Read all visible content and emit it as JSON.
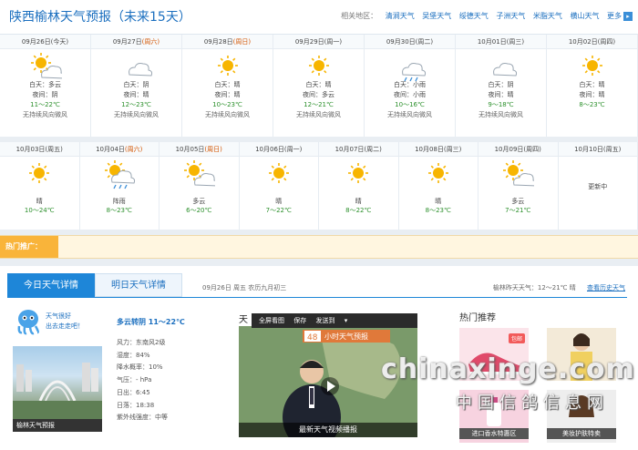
{
  "header": {
    "title": "陕西榆林天气预报（未来15天）",
    "nearby_label": "相关地区：",
    "nearby": [
      "清涧天气",
      "吴堡天气",
      "绥德天气",
      "子洲天气",
      "米脂天气",
      "横山天气"
    ],
    "more": "更多"
  },
  "row1": [
    {
      "date": "09月26日",
      "week": "(今天)",
      "day": "白天：多云",
      "night": "夜间：阴",
      "temp": "11～22℃",
      "wind": "无持续风向微风",
      "icon": "partly-cloudy-icon",
      "weekend": false
    },
    {
      "date": "09月27日",
      "week": "(周六)",
      "day": "白天：阴",
      "night": "夜间：晴",
      "temp": "12～23℃",
      "wind": "无持续风向微风",
      "icon": "cloud-icon",
      "weekend": true
    },
    {
      "date": "09月28日",
      "week": "(周日)",
      "day": "白天：晴",
      "night": "夜间：晴",
      "temp": "10～23℃",
      "wind": "无持续风向微风",
      "icon": "sun-icon",
      "weekend": true
    },
    {
      "date": "09月29日",
      "week": "(周一)",
      "day": "白天：晴",
      "night": "夜间：多云",
      "temp": "12～21℃",
      "wind": "无持续风向微风",
      "icon": "sun-icon",
      "weekend": false
    },
    {
      "date": "09月30日",
      "week": "(周二)",
      "day": "白天：小雨",
      "night": "夜间：小雨",
      "temp": "10～16℃",
      "wind": "无持续风向微风",
      "icon": "rain-icon",
      "weekend": false
    },
    {
      "date": "10月01日",
      "week": "(周三)",
      "day": "白天：阴",
      "night": "夜间：晴",
      "temp": "9～18℃",
      "wind": "无持续风向微风",
      "icon": "cloud-icon",
      "weekend": false
    },
    {
      "date": "10月02日",
      "week": "(周四)",
      "day": "白天：晴",
      "night": "夜间：晴",
      "temp": "8～23℃",
      "wind": "",
      "icon": "sun-icon",
      "weekend": false
    }
  ],
  "row2": [
    {
      "date": "10月03日",
      "week": "(周五)",
      "cond": "晴",
      "temp": "10～24℃",
      "icon": "sun-icon"
    },
    {
      "date": "10月04日",
      "week": "(周六)",
      "cond": "阵雨",
      "temp": "8～23℃",
      "icon": "shower-icon"
    },
    {
      "date": "10月05日",
      "week": "(周日)",
      "cond": "多云",
      "temp": "6～20℃",
      "icon": "partly-cloudy-icon"
    },
    {
      "date": "10月06日",
      "week": "(周一)",
      "cond": "晴",
      "temp": "7～22℃",
      "icon": "sun-icon"
    },
    {
      "date": "10月07日",
      "week": "(周二)",
      "cond": "晴",
      "temp": "8～22℃",
      "icon": "sun-icon"
    },
    {
      "date": "10月08日",
      "week": "(周三)",
      "cond": "晴",
      "temp": "8～23℃",
      "icon": "sun-icon"
    },
    {
      "date": "10月09日",
      "week": "(周四)",
      "cond": "多云",
      "temp": "7～21℃",
      "icon": "partly-cloudy-icon"
    },
    {
      "date": "10月10日",
      "week": "(周五)",
      "cond": "更新中",
      "temp": "",
      "icon": ""
    }
  ],
  "promo": {
    "label": "热门推广："
  },
  "details": {
    "tab_today": "今日天气详情",
    "tab_tomorrow": "明日天气详情",
    "date_line": "09月26日  周五  农历九月初三",
    "yesterday": "榆林昨天天气：12～21℃  晴",
    "history_link": "查看历史天气",
    "mascot_text_1": "天气很好",
    "mascot_text_2": "出去走走吧！",
    "summary": "多云转阴  11～22℃",
    "items": [
      "风力：东南风2级",
      "湿度：84%",
      "降水概率：10%",
      "气压：- hPa",
      "日出：6:45",
      "日落：18:38",
      "紫外线强度：中等"
    ],
    "photo_caption": "榆林天气预报"
  },
  "video": {
    "title": "天",
    "toolbar": [
      "全屏看图",
      "保存",
      "发送到"
    ],
    "caption": "最新天气视频播报",
    "inner_label": "小时天气预报",
    "inner_number": "48"
  },
  "hot": {
    "title": "热门推荐",
    "badge": "包邮",
    "captions": [
      "进口香水特惠区",
      "美妆护肤特卖"
    ]
  },
  "watermark": {
    "line1": "chinaxinge.com",
    "line2": "中国信鸽信息网"
  },
  "colors": {
    "accent": "#1e86d8",
    "weekend": "#d35400",
    "temp": "#2a8f2a",
    "promo": "#f9b43a"
  }
}
